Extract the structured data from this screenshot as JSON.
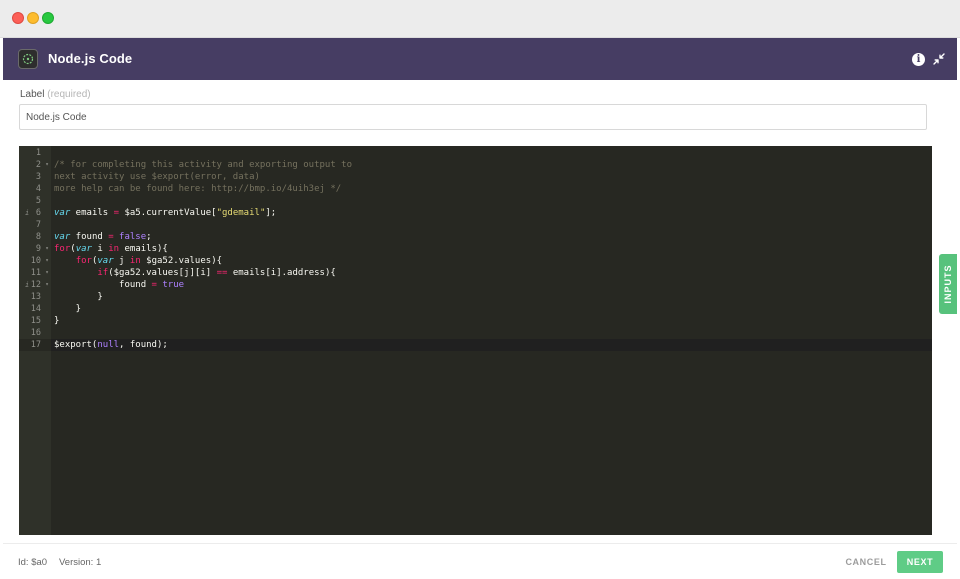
{
  "window": {
    "controls": [
      "close",
      "minimize",
      "zoom"
    ]
  },
  "header": {
    "title": "Node.js Code",
    "icons": [
      "code-icon",
      "info-icon",
      "collapse-icon"
    ],
    "info_glyph": "i",
    "color": "#463d63"
  },
  "label_field": {
    "label": "Label",
    "required": "(required)",
    "value": "Node.js Code"
  },
  "editor": {
    "theme_bg": "#272822",
    "lines": [
      {
        "num": "1"
      },
      {
        "num": "2",
        "fold": "▾"
      },
      {
        "num": "3"
      },
      {
        "num": "4"
      },
      {
        "num": "5"
      },
      {
        "num": "6",
        "warn": "i"
      },
      {
        "num": "7"
      },
      {
        "num": "8"
      },
      {
        "num": "9",
        "fold": "▾"
      },
      {
        "num": "10",
        "fold": "▾"
      },
      {
        "num": "11",
        "fold": "▾"
      },
      {
        "num": "12",
        "fold": "▾",
        "warn": "i"
      },
      {
        "num": "13"
      },
      {
        "num": "14"
      },
      {
        "num": "15"
      },
      {
        "num": "16"
      },
      {
        "num": "17"
      }
    ],
    "tokens": {
      "l2": "/* for completing this activity and exporting output to",
      "l3": "next activity use $export(error, data)",
      "l4": "more help can be found here: http://bmp.io/4uih3ej */",
      "l6_var": "var",
      "l6_a": " emails ",
      "l6_eq": "=",
      "l6_b": " $a5.currentValue[",
      "l6_str": "\"gdemail\"",
      "l6_c": "];",
      "l8_var": "var",
      "l8_a": " found ",
      "l8_eq": "=",
      "l8_sp": " ",
      "l8_false": "false",
      "l8_c": ";",
      "l9_for": "for",
      "l9_a": "(",
      "l9_var": "var",
      "l9_b": " i ",
      "l9_in": "in",
      "l9_c": " emails){",
      "l10_ind": "    ",
      "l10_for": "for",
      "l10_a": "(",
      "l10_var": "var",
      "l10_b": " j ",
      "l10_in": "in",
      "l10_c": " $ga52.values){",
      "l11_ind": "        ",
      "l11_if": "if",
      "l11_a": "($ga52.values[j][i] ",
      "l11_eq": "==",
      "l11_b": " emails[i].address){",
      "l12_ind": "            found ",
      "l12_eq": "=",
      "l12_sp": " ",
      "l12_true": "true",
      "l13": "        }",
      "l14": "    }",
      "l15": "}",
      "l17_a": "$export(",
      "l17_null": "null",
      "l17_b": ", found);"
    }
  },
  "inputs_tab": {
    "label": "INPUTS"
  },
  "footer": {
    "id_text": "Id: $a0",
    "version_text": "Version: 1",
    "cancel_label": "CANCEL",
    "next_label": "NEXT"
  }
}
